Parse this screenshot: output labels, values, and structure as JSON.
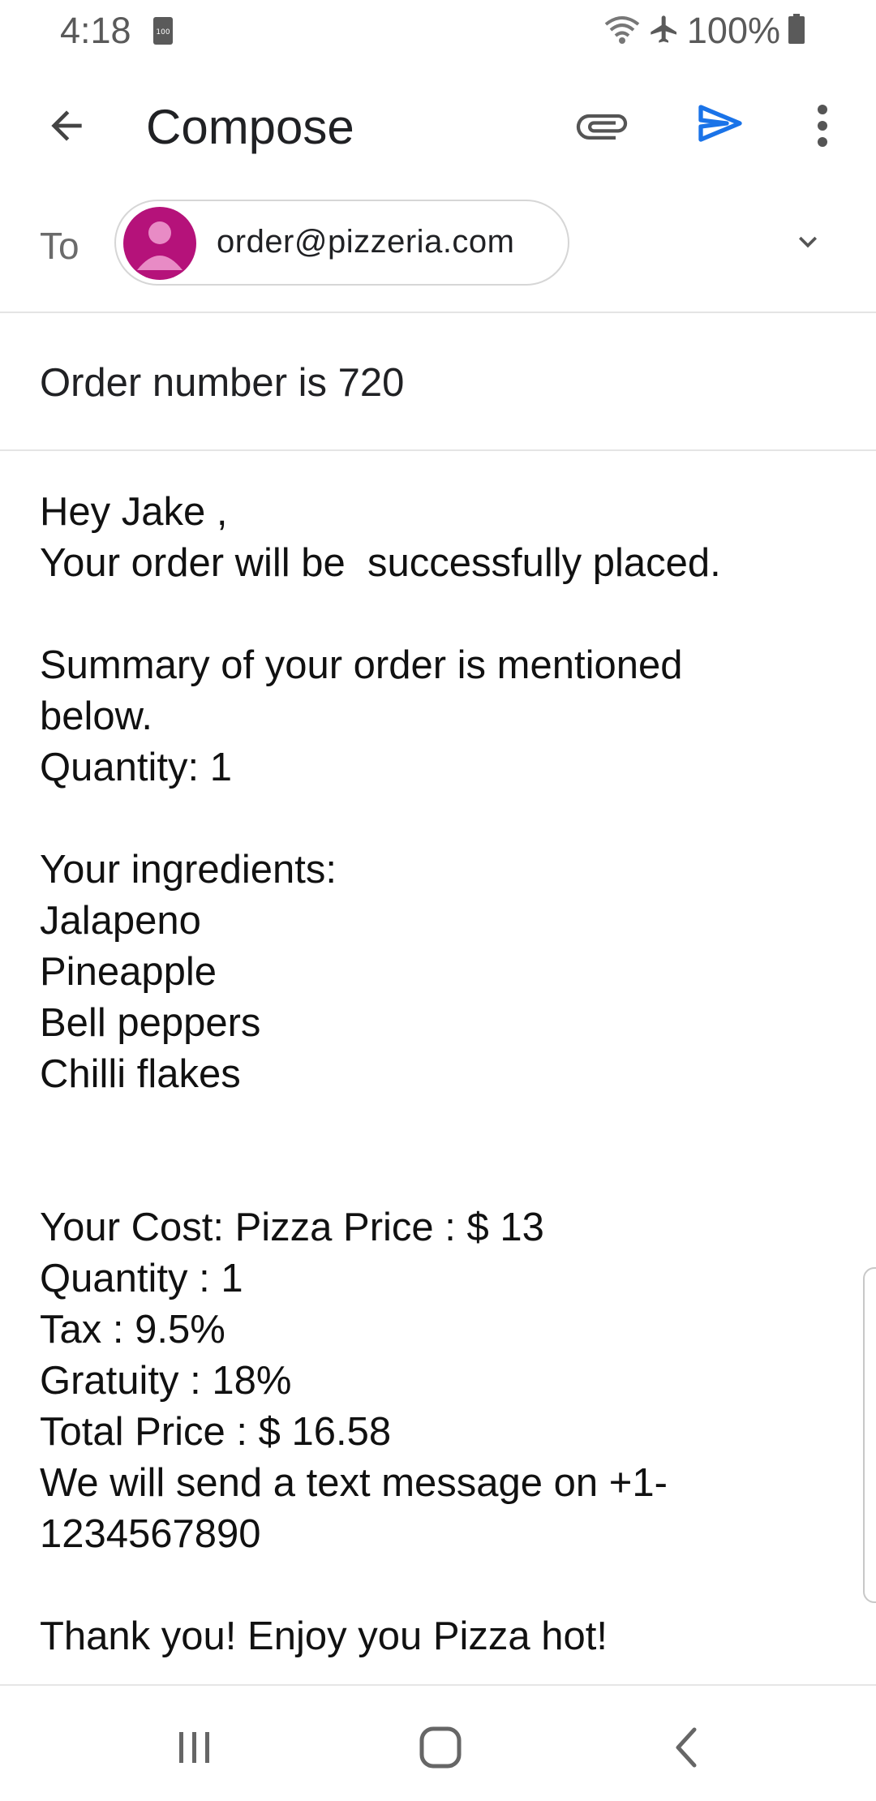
{
  "status_bar": {
    "time": "4:18",
    "battery_percent": "100%",
    "icons": [
      "notification-100-icon",
      "wifi-icon",
      "airplane-mode-icon",
      "battery-icon"
    ]
  },
  "app_bar": {
    "title": "Compose",
    "icons": [
      "back-arrow-icon",
      "attach-icon",
      "send-icon",
      "more-vert-icon"
    ],
    "accent_color": "#1a73e8"
  },
  "to": {
    "label": "To",
    "recipient": "order@pizzeria.com",
    "avatar_color": "#b5127a",
    "expand_icon": "chevron-down-icon"
  },
  "subject": {
    "value": "Order number is 720"
  },
  "body": {
    "lines": [
      "Hey Jake ,",
      "Your order will be  successfully placed.",
      "",
      "Summary of your order is mentioned",
      "below.",
      "Quantity: 1",
      "",
      "Your ingredients:",
      "Jalapeno",
      "Pineapple",
      "Bell peppers",
      "Chilli flakes",
      "",
      "",
      "Your Cost: Pizza Price : $ 13",
      "Quantity : 1",
      "Tax : 9.5%",
      "Gratuity : 18%",
      "Total Price : $ 16.58",
      "We will send a text message on +1-",
      "1234567890",
      "",
      "Thank you! Enjoy you Pizza hot!"
    ]
  },
  "nav_bar": {
    "icons": [
      "recent-apps-icon",
      "home-icon",
      "back-icon"
    ]
  }
}
